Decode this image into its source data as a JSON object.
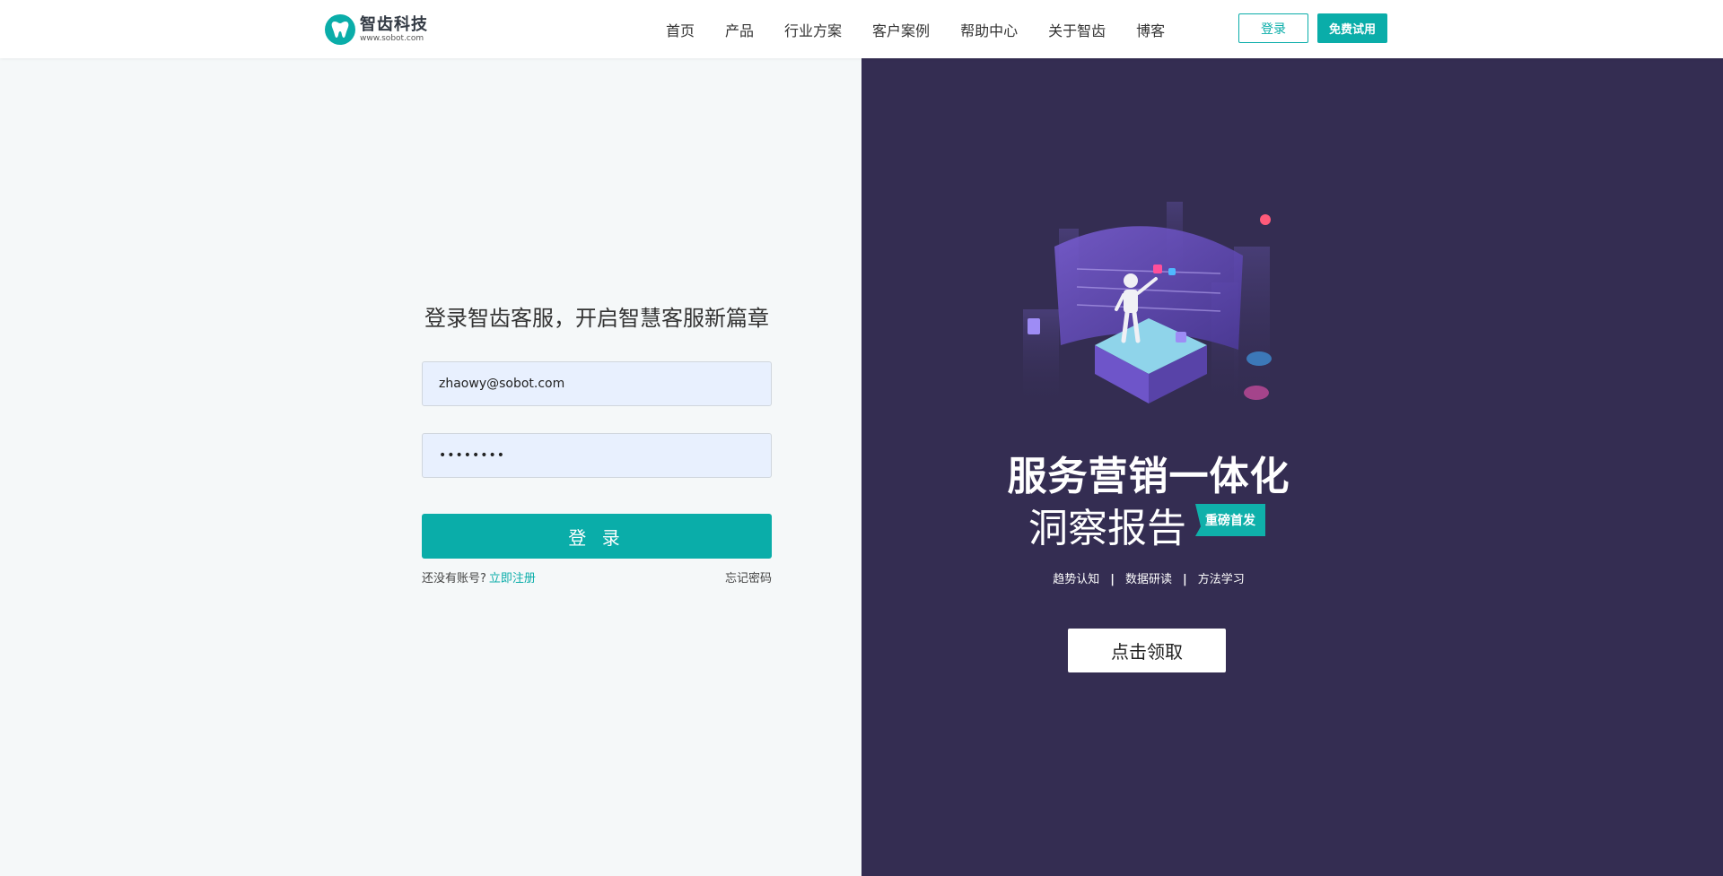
{
  "header": {
    "logo": {
      "name": "智齿科技",
      "url": "www.sobot.com",
      "icon": "tooth-icon"
    },
    "nav": [
      "首页",
      "产品",
      "行业方案",
      "客户案例",
      "帮助中心",
      "关于智齿",
      "博客"
    ],
    "login_label": "登录",
    "trial_label": "免费试用"
  },
  "login": {
    "title": "登录智齿客服，开启智慧客服新篇章",
    "email_value": "zhaowy@sobot.com",
    "password_value": "••••••••",
    "submit_label": "登 录",
    "no_account_text": "还没有账号?",
    "register_label": "立即注册",
    "forgot_label": "忘记密码"
  },
  "promo": {
    "title_line1": "服务营销一体化",
    "title_line2": "洞察报告",
    "badge": "重磅首发",
    "tags": [
      "趋势认知",
      "数据研读",
      "方法学习"
    ],
    "tag_separator": "|",
    "cta_label": "点击领取"
  },
  "colors": {
    "accent": "#0aada9",
    "promo_background": "#342d52",
    "page_background": "#f5f8f9",
    "input_background": "#e8f0fe"
  }
}
